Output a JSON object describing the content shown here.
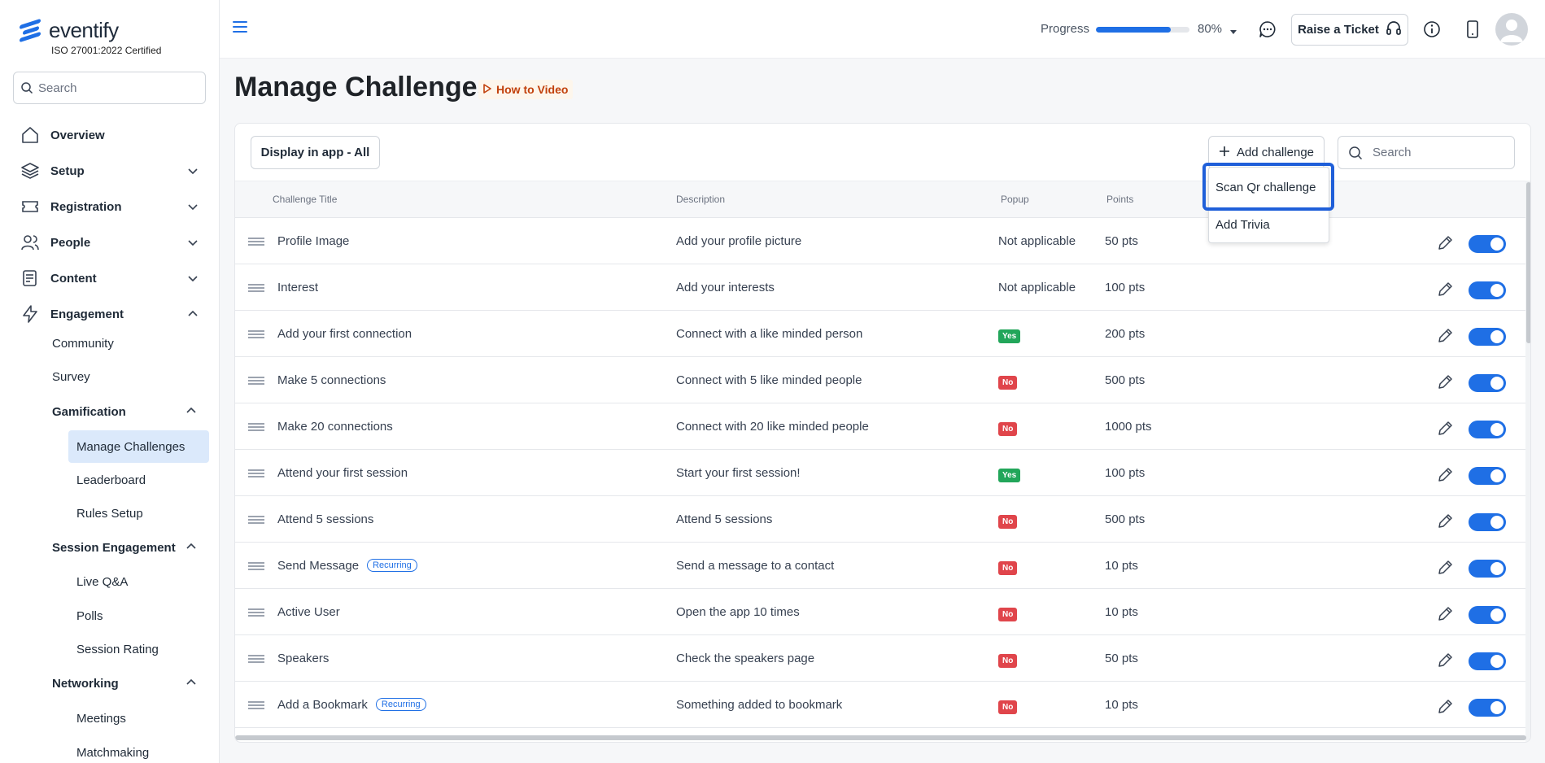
{
  "brand": {
    "name": "eventify",
    "cert": "ISO 27001:2022 Certified"
  },
  "sidebar": {
    "search_placeholder": "Search",
    "items": [
      {
        "label": "Overview",
        "icon": "home-icon"
      },
      {
        "label": "Setup",
        "icon": "layers-icon"
      },
      {
        "label": "Registration",
        "icon": "ticket-icon"
      },
      {
        "label": "People",
        "icon": "people-icon"
      },
      {
        "label": "Content",
        "icon": "document-icon"
      },
      {
        "label": "Engagement",
        "icon": "lightning-icon"
      }
    ],
    "sub": {
      "community": "Community",
      "survey": "Survey",
      "gamification": "Gamification",
      "manage_challenges": "Manage Challenges",
      "leaderboard": "Leaderboard",
      "rules_setup": "Rules Setup",
      "session_engagement": "Session Engagement",
      "live_qa": "Live Q&A",
      "polls": "Polls",
      "session_rating": "Session Rating",
      "networking": "Networking",
      "meetings": "Meetings",
      "matchmaking": "Matchmaking"
    }
  },
  "header": {
    "progress_label": "Progress",
    "progress_value": "80%",
    "progress_fraction": 0.8,
    "ticket_label": "Raise a Ticket",
    "accent": "#1f6fe5"
  },
  "page": {
    "title": "Manage Challenges",
    "howto": "How to Video"
  },
  "toolbar": {
    "display_filter": "Display in app - All",
    "add_label": "Add challenge",
    "search_placeholder": "Search"
  },
  "dropdown": {
    "items": [
      "Scan Qr challenge",
      "Add Trivia"
    ]
  },
  "table": {
    "columns": [
      "Challenge Title",
      "Description",
      "Popup",
      "Points"
    ],
    "rows": [
      {
        "title": "Profile Image",
        "recurring": "",
        "description": "Add your profile picture",
        "popup": "Not applicable",
        "popup_type": "text",
        "points": "50 pts"
      },
      {
        "title": "Interest",
        "recurring": "",
        "description": "Add your interests",
        "popup": "Not applicable",
        "popup_type": "text",
        "points": "100 pts"
      },
      {
        "title": "Add your first connection",
        "recurring": "",
        "description": "Connect with a like minded person",
        "popup": "Yes",
        "popup_type": "yes",
        "points": "200 pts"
      },
      {
        "title": "Make 5 connections",
        "recurring": "",
        "description": "Connect with 5 like minded people",
        "popup": "No",
        "popup_type": "no",
        "points": "500 pts"
      },
      {
        "title": "Make 20 connections",
        "recurring": "",
        "description": "Connect with 20 like minded people",
        "popup": "No",
        "popup_type": "no",
        "points": "1000 pts"
      },
      {
        "title": "Attend your first session",
        "recurring": "",
        "description": "Start your first session!",
        "popup": "Yes",
        "popup_type": "yes",
        "points": "100 pts"
      },
      {
        "title": "Attend 5 sessions",
        "recurring": "",
        "description": "Attend 5 sessions",
        "popup": "No",
        "popup_type": "no",
        "points": "500 pts"
      },
      {
        "title": "Send Message",
        "recurring": "Recurring",
        "description": "Send a message to a contact",
        "popup": "No",
        "popup_type": "no",
        "points": "10 pts"
      },
      {
        "title": "Active User",
        "recurring": "",
        "description": "Open the app 10 times",
        "popup": "No",
        "popup_type": "no",
        "points": "10 pts"
      },
      {
        "title": "Speakers",
        "recurring": "",
        "description": "Check the speakers page",
        "popup": "No",
        "popup_type": "no",
        "points": "50 pts"
      },
      {
        "title": "Add a Bookmark",
        "recurring": "Recurring",
        "description": "Something added to bookmark",
        "popup": "No",
        "popup_type": "no",
        "points": "10 pts"
      }
    ]
  }
}
